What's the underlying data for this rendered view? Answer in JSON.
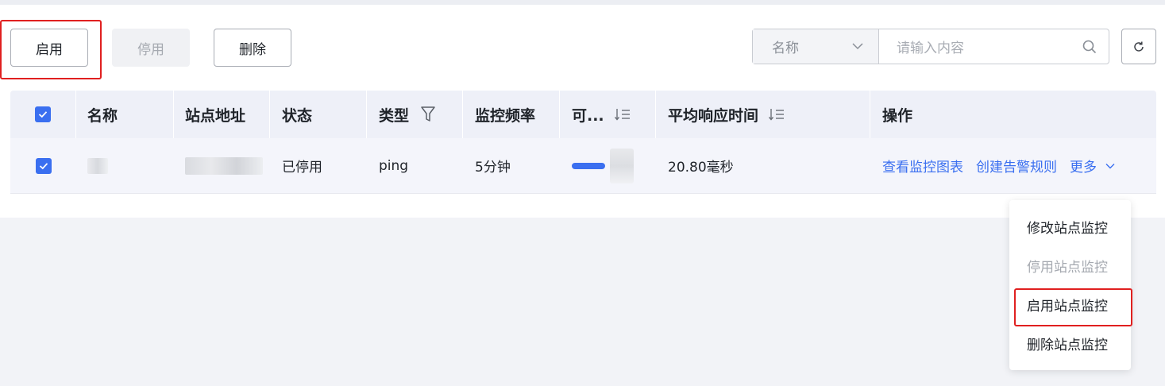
{
  "toolbar": {
    "enable_label": "启用",
    "disable_label": "停用",
    "delete_label": "删除"
  },
  "search": {
    "field_select_value": "名称",
    "placeholder": "请输入内容"
  },
  "table": {
    "headers": {
      "name": "名称",
      "url": "站点地址",
      "status": "状态",
      "type": "类型",
      "frequency": "监控频率",
      "availability": "可...",
      "avg_response": "平均响应时间",
      "operations": "操作"
    },
    "rows": [
      {
        "status": "已停用",
        "type": "ping",
        "frequency": "5分钟",
        "avg_response": "20.80毫秒",
        "ops": {
          "view_chart": "查看监控图表",
          "create_alert": "创建告警规则",
          "more": "更多"
        }
      }
    ]
  },
  "dropdown": {
    "items": [
      {
        "label": "修改站点监控",
        "disabled": false
      },
      {
        "label": "停用站点监控",
        "disabled": true
      },
      {
        "label": "启用站点监控",
        "disabled": false
      },
      {
        "label": "删除站点监控",
        "disabled": false
      }
    ]
  },
  "colors": {
    "accent": "#3a6ff0",
    "highlight": "#e02020",
    "header_bg": "#eef0f8",
    "page_bg": "#f2f3f7"
  },
  "icons": {
    "search": "search-icon",
    "refresh": "refresh-icon",
    "dropdown": "chevron-down-icon",
    "filter": "filter-icon",
    "sort": "sort-icon",
    "checkbox": "checkbox-checked-icon"
  }
}
